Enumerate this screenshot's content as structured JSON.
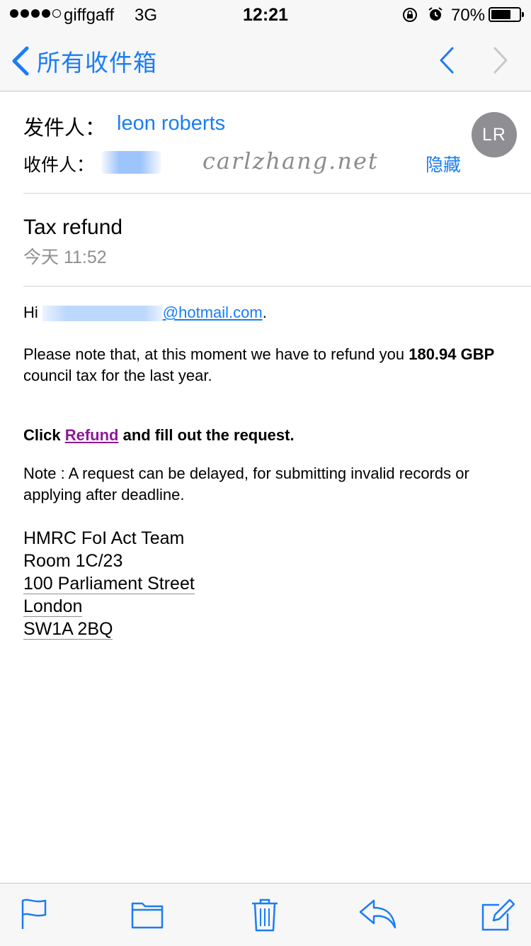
{
  "status_bar": {
    "carrier": "giffgaff",
    "network": "3G",
    "time": "12:21",
    "battery_percent": "70%",
    "battery_level": 0.7,
    "signal_bars_filled": 4,
    "signal_bars_total": 5
  },
  "nav": {
    "back_label": "所有收件箱"
  },
  "header": {
    "from_label": "发件人：",
    "from_name": "leon roberts",
    "avatar_initials": "LR",
    "to_label": "收件人：",
    "watermark": "carlzhang.net",
    "hide_label": "隐藏"
  },
  "message": {
    "subject": "Tax refund",
    "date": "今天 11:52",
    "greeting": "Hi",
    "email_domain": "@hotmail.com",
    "greeting_end": ".",
    "para1_start": "Please note that, at this moment we have to refund you ",
    "para1_bold": "180.94 GBP",
    "para1_end": " council tax for the last year.",
    "click_text": "Click ",
    "refund_link": "Refund",
    "click_end": " and fill out the request.",
    "note": "Note : A request can be delayed, for submitting invalid records or applying after deadline.",
    "signature": {
      "line1": "HMRC FoI Act Team",
      "line2": "Room 1C/23",
      "line3": "100 Parliament Street",
      "line4": "London",
      "line5": "SW1A 2BQ"
    }
  },
  "colors": {
    "accent": "#1a7df6",
    "link_visited": "#8b1a96",
    "avatar_bg": "#8e8e93"
  },
  "toolbar": {
    "icons": [
      "flag-icon",
      "folder-icon",
      "trash-icon",
      "reply-icon",
      "compose-icon"
    ]
  }
}
